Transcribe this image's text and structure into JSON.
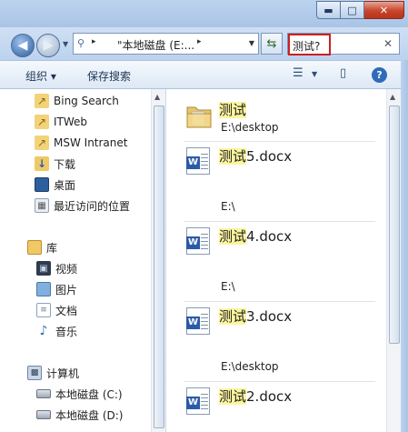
{
  "window": {
    "min_label": "▬",
    "max_label": "□",
    "close_label": "✕"
  },
  "nav": {
    "back_arrow": "◀",
    "forward_arrow": "▶",
    "history_dropdown": "▼"
  },
  "address": {
    "location": "\"本地磁盘 (E:...",
    "chevron": "▸",
    "dropdown": "▼",
    "refresh_icon": "⇆"
  },
  "search": {
    "query": "测试?",
    "clear": "✕"
  },
  "toolbar": {
    "organize_label": "组织 ▾",
    "save_search_label": "保存搜索",
    "view_icon": "☰",
    "view_dropdown": "▼",
    "preview_pane_icon": "▯",
    "help_icon": "?"
  },
  "sidebar": {
    "favorites": [
      {
        "label": "Bing Search",
        "icon": "favorite-link-icon"
      },
      {
        "label": "ITWeb",
        "icon": "favorite-link-icon"
      },
      {
        "label": "MSW Intranet",
        "icon": "favorite-link-icon"
      },
      {
        "label": "下载",
        "icon": "downloads-icon"
      },
      {
        "label": "桌面",
        "icon": "desktop-icon"
      },
      {
        "label": "最近访问的位置",
        "icon": "recent-places-icon"
      }
    ],
    "libraries_label": "库",
    "libraries": [
      {
        "label": "视频",
        "icon": "videos-icon"
      },
      {
        "label": "图片",
        "icon": "pictures-icon"
      },
      {
        "label": "文档",
        "icon": "documents-icon"
      },
      {
        "label": "音乐",
        "icon": "music-icon"
      }
    ],
    "computer_label": "计算机",
    "drives": [
      {
        "label": "本地磁盘 (C:)",
        "icon": "drive-icon"
      },
      {
        "label": "本地磁盘 (D:)",
        "icon": "drive-icon"
      }
    ]
  },
  "results": [
    {
      "match": "测试",
      "rest": "",
      "path": "E:\\desktop",
      "type": "folder"
    },
    {
      "match": "测试",
      "rest": "5.docx",
      "path": "E:\\",
      "type": "docx"
    },
    {
      "match": "测试",
      "rest": "4.docx",
      "path": "E:\\",
      "type": "docx"
    },
    {
      "match": "测试",
      "rest": "3.docx",
      "path": "E:\\desktop",
      "type": "docx"
    },
    {
      "match": "测试",
      "rest": "2.docx",
      "path": "",
      "type": "docx"
    }
  ],
  "colors": {
    "highlight": "#fdf59e",
    "search_outline": "#cc1f1f",
    "frame": "#bcd2ee"
  }
}
